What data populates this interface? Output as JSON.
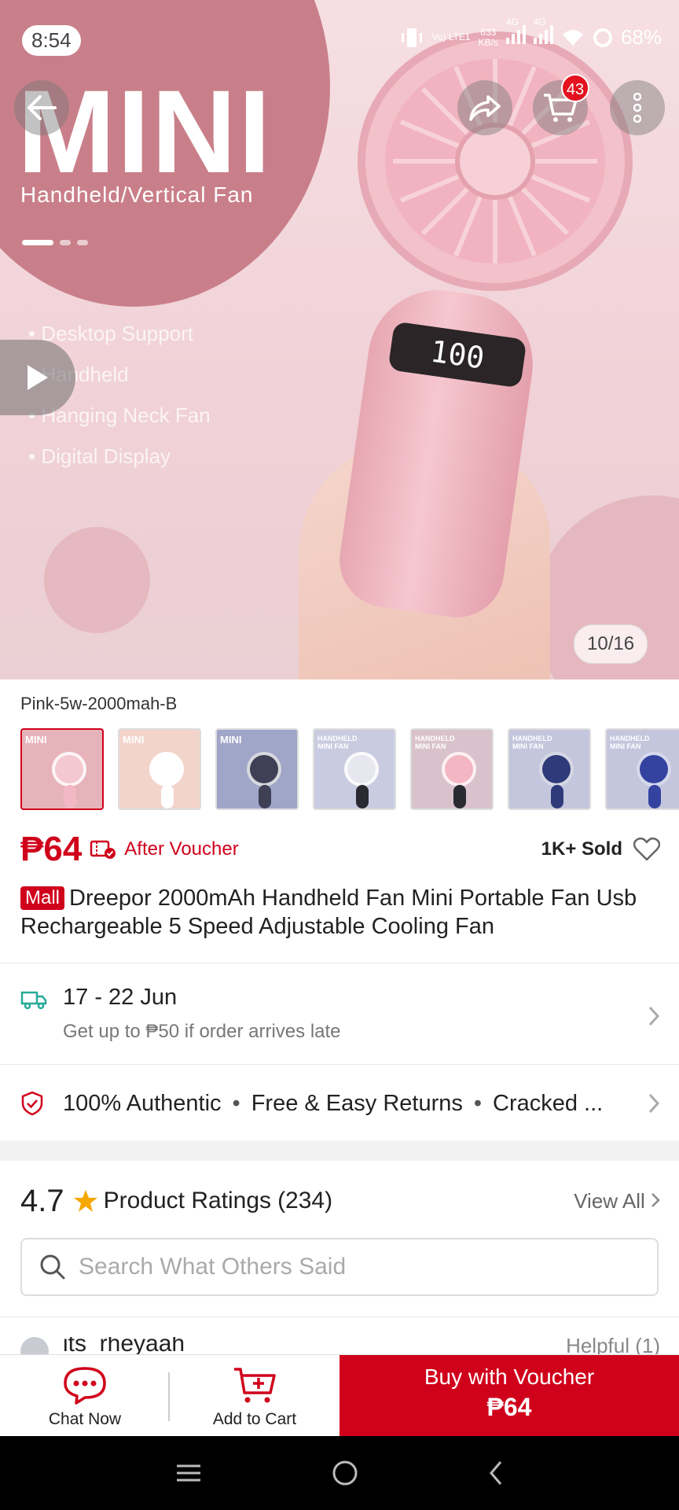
{
  "status_bar": {
    "time": "8:54",
    "net_speed_value": "633",
    "net_speed_unit": "KB/s",
    "volte": "Vo) LTE1",
    "net1": "4G",
    "net2": "4G",
    "battery": "68%"
  },
  "hero": {
    "title": "MINI",
    "subtitle": "Handheld/Vertical Fan",
    "features": [
      "• Desktop Support",
      "• Handheld",
      "• Hanging Neck Fan",
      "• Digital Display"
    ],
    "display_text": "100",
    "image_counter": "10/16"
  },
  "top_actions": {
    "cart_badge": "43"
  },
  "product": {
    "variant_name": "Pink-5w-2000mah-B",
    "thumbnails": [
      {
        "label": "MINI",
        "bg": "#e7b3bb",
        "fan": "#f4c8d0",
        "stick": "#f2b8c3"
      },
      {
        "label": "MINI",
        "bg": "#f3d4cb",
        "fan": "#ffffff",
        "stick": "#ffffff"
      },
      {
        "label": "MINI",
        "bg": "#9fa6c8",
        "fan": "#3f3f55",
        "stick": "#3f3f55"
      },
      {
        "label": "HANDHELD MINI FAN",
        "bg": "#c9cbe0",
        "fan": "#e7e7ef",
        "stick": "#2a2a32"
      },
      {
        "label": "HANDHELD MINI FAN",
        "bg": "#d9c2cc",
        "fan": "#f3b6c2",
        "stick": "#2a2a32"
      },
      {
        "label": "HANDHELD MINI FAN",
        "bg": "#c4c6dd",
        "fan": "#2f3a7a",
        "stick": "#2f3a7a"
      },
      {
        "label": "HANDHELD MINI FAN",
        "bg": "#c4c6dd",
        "fan": "#3442a0",
        "stick": "#3442a0"
      }
    ],
    "price": "₱64",
    "after_voucher": "After Voucher",
    "sold": "1K+ Sold",
    "mall_badge": "Mall",
    "title": "Dreepor  2000mAh Handheld Fan Mini Portable Fan Usb Rechargeable 5 Speed Adjustable Cooling Fan"
  },
  "delivery": {
    "date_range": "17 - 22 Jun",
    "late_note": "Get up to ₱50 if order arrives late"
  },
  "guarantees": {
    "item1": "100% Authentic",
    "item2": "Free & Easy Returns",
    "item3": "Cracked ..."
  },
  "ratings": {
    "score": "4.7",
    "label": "Product Ratings",
    "count": "(234)",
    "view_all": "View All",
    "search_placeholder": "Search What Others Said",
    "reviewer": "its_rheyaah",
    "helpful": "Helpful (1)"
  },
  "bottom_bar": {
    "chat": "Chat Now",
    "add_to_cart": "Add to Cart",
    "buy_line1": "Buy with Voucher",
    "buy_line2": "₱64"
  },
  "colors": {
    "accent": "#d0011b",
    "star": "#f6a700",
    "delivery_icon": "#26aa99"
  },
  "icons": [
    "back-arrow-icon",
    "share-icon",
    "cart-icon",
    "more-vertical-icon",
    "play-icon",
    "truck-icon",
    "shield-check-icon",
    "star-icon",
    "search-icon",
    "heart-icon",
    "chat-icon",
    "add-cart-icon",
    "nav-menu-icon",
    "nav-home-icon",
    "nav-back-icon"
  ]
}
